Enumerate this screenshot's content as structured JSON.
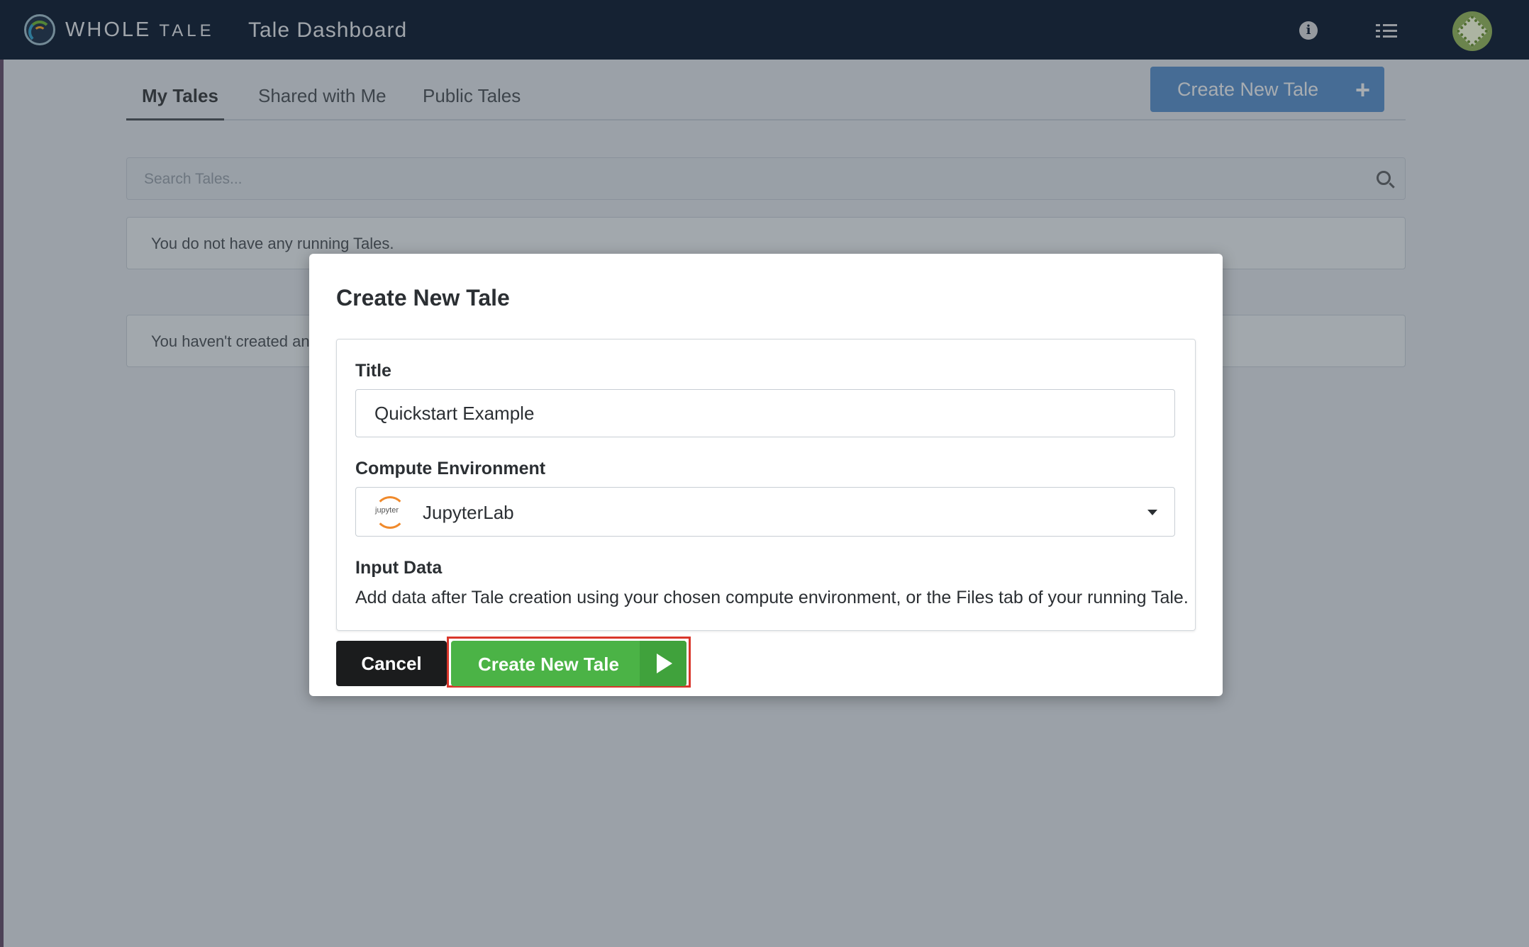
{
  "topbar": {
    "brand_main": "WHOLE",
    "brand_sub": "TALE",
    "page_title": "Tale Dashboard",
    "info_icon": "info-icon",
    "tasks_icon": "tasks-icon"
  },
  "tabs": [
    {
      "label": "My Tales",
      "active": true
    },
    {
      "label": "Shared with Me",
      "active": false
    },
    {
      "label": "Public Tales",
      "active": false
    }
  ],
  "create_top": {
    "label": "Create New Tale",
    "icon": "plus-icon"
  },
  "search": {
    "placeholder": "Search Tales..."
  },
  "notices": {
    "running": "You do not have any running Tales.",
    "created": "You haven't created any"
  },
  "modal": {
    "title": "Create New Tale",
    "title_label": "Title",
    "title_value": "Quickstart Example",
    "env_label": "Compute Environment",
    "env_value": "JupyterLab",
    "env_icon_text": "jupyter",
    "input_label": "Input Data",
    "input_desc": "Add data after Tale creation using your chosen compute environment, or the Files tab of your running Tale.",
    "cancel_label": "Cancel",
    "create_label": "Create New Tale"
  },
  "colors": {
    "topbar": "#1d2e44",
    "primary_blue": "#3d7fc6",
    "create_green": "#4bb346",
    "highlight_red": "#d9362b"
  }
}
